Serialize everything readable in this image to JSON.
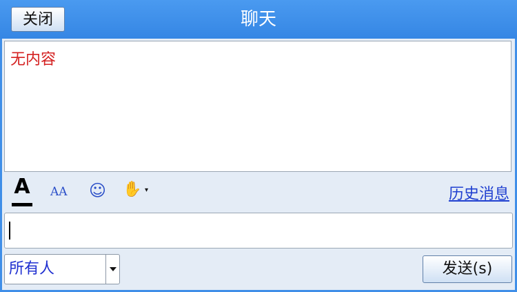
{
  "header": {
    "close_label": "关闭",
    "title": "聊天"
  },
  "messages": {
    "empty_text": "无内容"
  },
  "toolbar": {
    "font_color_glyph": "A",
    "font_size_glyph": "AA",
    "emoji_glyph": "☺",
    "gesture_glyph": "✋",
    "dropdown_glyph": "▾",
    "history_label": "历史消息",
    "icons": [
      "font-color-icon",
      "font-size-icon",
      "emoji-icon",
      "gesture-icon"
    ]
  },
  "composer": {
    "value": ""
  },
  "footer": {
    "recipient_selected": "所有人",
    "send_label": "发送(s)"
  },
  "colors": {
    "title_bar": "#3f8ee8",
    "empty_text": "#d42020",
    "link": "#1f3fd0"
  }
}
